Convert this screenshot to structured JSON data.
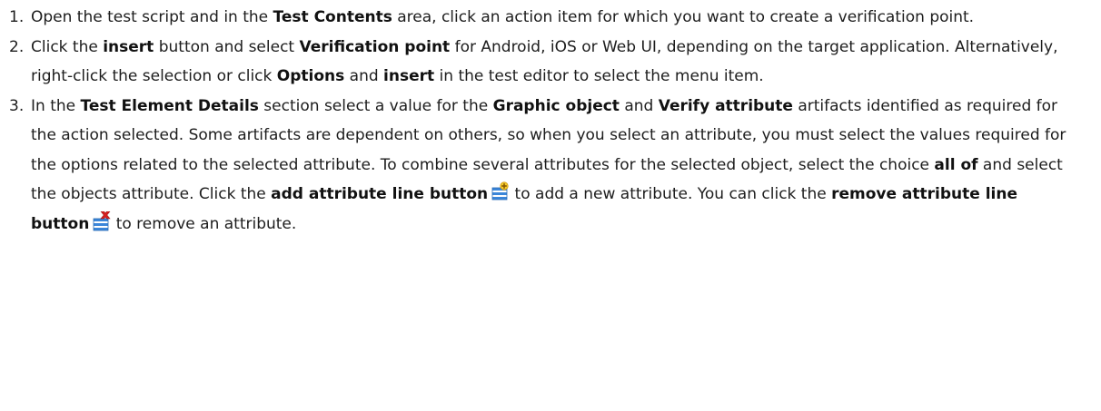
{
  "steps": [
    {
      "number": "1.",
      "parts": [
        "Open the test script and in the ",
        "Test Contents",
        " area, click an action item for which you want to create a verification point."
      ]
    },
    {
      "number": "2.",
      "parts": [
        "Click the ",
        "insert",
        " button and select ",
        "Verification point",
        " for Android, iOS or Web UI, depending on the target application. Alternatively, right-click the selection or click ",
        "Options",
        " and ",
        "insert",
        " in the test editor to select the menu item."
      ]
    },
    {
      "number": "3.",
      "parts": [
        "In the ",
        "Test Element Details",
        " section select a value for the ",
        "Graphic object",
        " and ",
        "Verify attribute",
        " artifacts identified as required for the action selected. Some artifacts are dependent on others, so when you select an attribute, you must select the values required for the options related to the selected attribute. To combine several attributes for the selected object, select the choice ",
        "all of",
        " and select the objects attribute. Click the ",
        "add attribute line button",
        " to add a new attribute. You can click the ",
        "remove attribute line button",
        " to remove an attribute."
      ]
    }
  ],
  "icons": {
    "add_line": "add-attribute-line-icon",
    "remove_line": "remove-attribute-line-icon",
    "accent_blue": "#2f7fd8",
    "accent_red": "#d42020",
    "accent_yellow": "#f0c419"
  }
}
